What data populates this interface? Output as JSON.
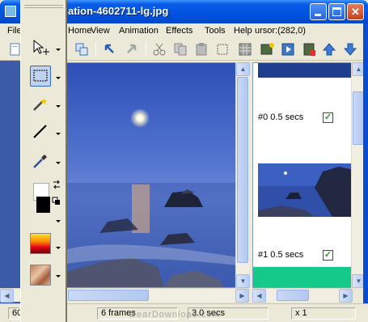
{
  "window": {
    "title": "ation-4602711-lg.jpg",
    "minimize_glyph": "_",
    "maximize_glyph": "□",
    "close_glyph": "✕"
  },
  "menu": {
    "items": [
      {
        "label": "File"
      },
      {
        "label": "Home"
      },
      {
        "label": "View"
      },
      {
        "label": "Animation"
      },
      {
        "label": "Effects"
      },
      {
        "label": "Tools"
      },
      {
        "label": "Help"
      }
    ],
    "cursor_readout": "ursor:(282,0)"
  },
  "toolbar": {
    "icons": [
      "new-icon",
      "save-icon",
      "copy-frames-icon",
      "undo-icon",
      "redo-icon",
      "cut-icon",
      "copy-icon",
      "paste-icon",
      "crop-icon",
      "grid-icon",
      "add-frames-icon",
      "insert-frame-icon",
      "play-icon",
      "stop-icon",
      "move-up-icon",
      "move-down-icon"
    ]
  },
  "toolbox": {
    "tools": [
      {
        "name": "move-tool",
        "icon": "move-icon",
        "selected": false
      },
      {
        "name": "rect-select-tool",
        "icon": "rectangle-select-icon",
        "selected": true
      },
      {
        "name": "magic-wand-tool",
        "icon": "magic-wand-icon",
        "selected": false
      },
      {
        "name": "line-tool",
        "icon": "line-icon",
        "selected": false
      },
      {
        "name": "eyedropper-tool",
        "icon": "eyedropper-icon",
        "selected": false
      }
    ],
    "foreground_color": "#000000",
    "background_color": "#ffffff"
  },
  "frames": [
    {
      "label": "#0  0.5 secs",
      "checked": true
    },
    {
      "label": "#1  0.5 secs",
      "checked": true
    }
  ],
  "status": {
    "zoom": "60",
    "frames": "6 frames",
    "duration": "3.0 secs",
    "scale": "x 1"
  },
  "watermark": "DearDownload.com",
  "colors": {
    "titlebar": "#0054e3",
    "selection_highlight": "#c1d2ee",
    "frame_green": "#14c98a",
    "checkmark": "#21a121"
  }
}
